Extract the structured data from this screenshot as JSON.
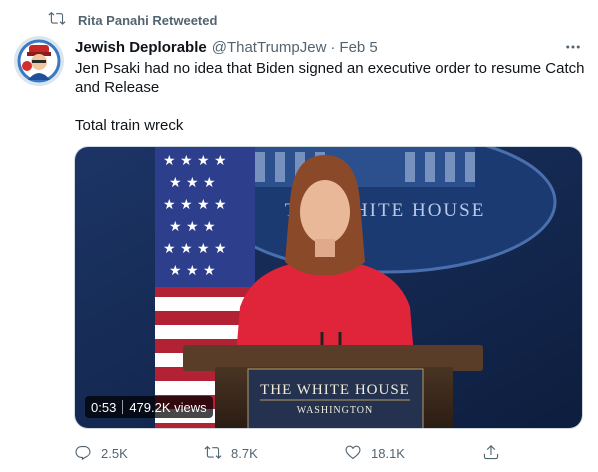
{
  "retweet_context": {
    "label": "Rita Panahi Retweeted"
  },
  "tweet": {
    "author_name": "Jewish Deplorable",
    "handle": "@ThatTrumpJew",
    "separator": "·",
    "date": "Feb 5",
    "text_lines": [
      "Jen Psaki had no idea that Biden signed an executive order to resume Catch and Release",
      "Total train wreck"
    ]
  },
  "media": {
    "type": "video",
    "duration": "0:53",
    "views": "479.2K views",
    "backdrop_text": "THE WHITE HOUSE",
    "podium_title": "THE WHITE HOUSE",
    "podium_subtitle": "WASHINGTON"
  },
  "actions": {
    "replies": "2.5K",
    "retweets": "8.7K",
    "likes": "18.1K"
  },
  "colors": {
    "secondary_text": "#536471",
    "primary_text": "#0f1419"
  },
  "icons": [
    "retweet-icon",
    "more-icon",
    "reply-icon",
    "like-icon",
    "share-icon"
  ]
}
